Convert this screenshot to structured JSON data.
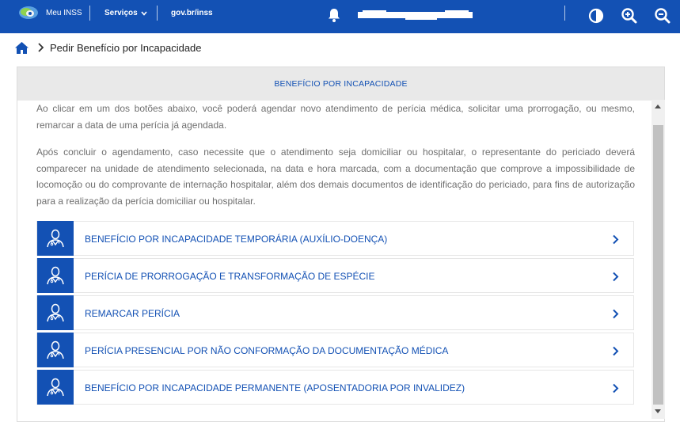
{
  "colors": {
    "primary": "#1351b4",
    "header_bg": "#e9e9e9",
    "text_muted": "#6f6f6f"
  },
  "topbar": {
    "brand": "Meu INSS",
    "services": "Serviços",
    "govbr": "gov.br/inss",
    "icons": [
      "inss-logo-icon",
      "chevron-down-icon",
      "bell-icon",
      "contrast-icon",
      "zoom-in-icon",
      "zoom-out-icon"
    ]
  },
  "breadcrumb": {
    "current": "Pedir Benefício por Incapacidade"
  },
  "panel": {
    "title": "BENEFÍCIO POR INCAPACIDADE",
    "paragraph1": "Ao clicar em um dos botões abaixo, você poderá agendar novo atendimento de perícia médica, solicitar uma prorrogação, ou mesmo, remarcar a data de uma perícia já agendada.",
    "paragraph2": "Após concluir o agendamento, caso necessite que o atendimento seja domiciliar ou hospitalar, o representante do periciado deverá comparecer na unidade de atendimento selecionada, na data e hora marcada, com a documentação que comprove a impossibilidade de locomoção ou do comprovante de internação hospitalar, além dos demais documentos de identificação do periciado, para fins de autorização para a realização da perícia domiciliar ou hospitalar.",
    "options": [
      {
        "label": "BENEFÍCIO POR INCAPACIDADE TEMPORÁRIA (AUXÍLIO-DOENÇA)"
      },
      {
        "label": "PERÍCIA DE PRORROGAÇÃO E TRANSFORMAÇÃO DE ESPÉCIE"
      },
      {
        "label": "REMARCAR PERÍCIA"
      },
      {
        "label": "PERÍCIA PRESENCIAL POR NÃO CONFORMAÇÃO DA DOCUMENTAÇÃO MÉDICA"
      },
      {
        "label": "BENEFÍCIO POR INCAPACIDADE PERMANENTE (APOSENTADORIA POR INVALIDEZ)"
      }
    ]
  }
}
